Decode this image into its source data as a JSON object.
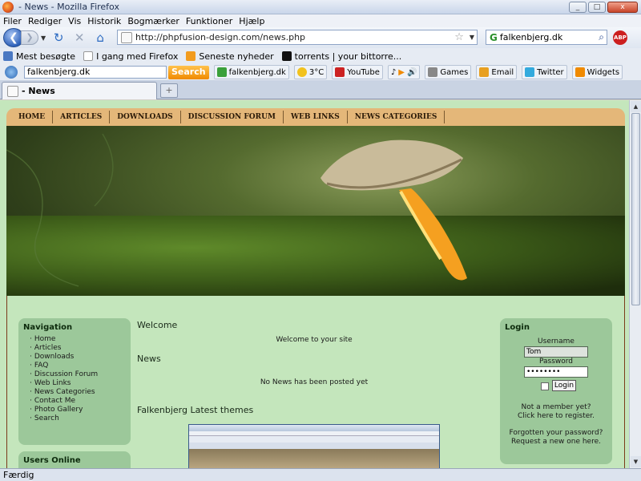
{
  "window": {
    "title": "- News - Mozilla Firefox",
    "buttons": [
      "_",
      "□",
      "x"
    ]
  },
  "menu": [
    "Filer",
    "Rediger",
    "Vis",
    "Historik",
    "Bogmærker",
    "Funktioner",
    "Hjælp"
  ],
  "navbar": {
    "url": "http://phpfusion-design.com/news.php",
    "search_value": "falkenbjerg.dk",
    "search_engine": "G",
    "abp": "ABP"
  },
  "bookmarks": [
    {
      "label": "Mest besøgte",
      "color": "#4a78c2"
    },
    {
      "label": "I gang med Firefox",
      "color": "#ffffff"
    },
    {
      "label": "Seneste nyheder",
      "color": "#f29b1d"
    },
    {
      "label": "torrents | your bittorre...",
      "color": "#111111"
    }
  ],
  "toolbar2": {
    "search_value": "falkenbjerg.dk",
    "search_button": "Search",
    "items": [
      {
        "label": "falkenbjerg.dk",
        "color": "#3aa03a"
      },
      {
        "label": "3°C",
        "color": "#f2c21d"
      },
      {
        "label": "YouTube",
        "color": "#cc2222"
      },
      {
        "label": "Games",
        "color": "#888888"
      },
      {
        "label": "Email",
        "color": "#e8a020"
      },
      {
        "label": "Twitter",
        "color": "#33aadd"
      },
      {
        "label": "Widgets",
        "color": "#f08a00"
      }
    ]
  },
  "tab": {
    "label": "- News"
  },
  "status": "Færdig",
  "site": {
    "nav": [
      "HOME",
      "ARTICLES",
      "DOWNLOADS",
      "DISCUSSION FORUM",
      "WEB LINKS",
      "NEWS CATEGORIES"
    ],
    "navigation": {
      "title": "Navigation",
      "items": [
        "Home",
        "Articles",
        "Downloads",
        "FAQ",
        "Discussion Forum",
        "Web Links",
        "News Categories",
        "Contact Me",
        "Photo Gallery",
        "Search"
      ]
    },
    "users_online": "Users Online",
    "welcome_title": "Welcome",
    "welcome_text": "Welcome to your site",
    "news_title": "News",
    "news_text": "No News has been posted yet",
    "themes_title": "Falkenbjerg Latest themes",
    "login": {
      "title": "Login",
      "username_label": "Username",
      "username_value": "Tom",
      "password_label": "Password",
      "password_value": "••••••••",
      "button": "Login",
      "member_q": "Not a member yet?",
      "register": "Click here to register.",
      "forgot": "Forgotten your password?",
      "request": "Request a new one here."
    }
  }
}
